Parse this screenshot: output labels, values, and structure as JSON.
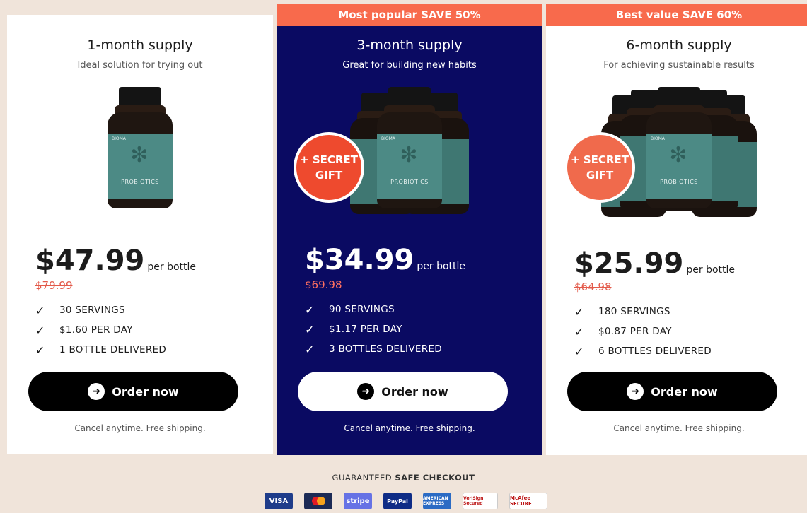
{
  "plans": [
    {
      "banner": "",
      "title": "1-month supply",
      "subtitle": "Ideal solution for trying out",
      "gift": "",
      "price": "$47.99",
      "per": "per bottle",
      "old_price": "$79.99",
      "features": [
        "30 SERVINGS",
        "$1.60 PER DAY",
        "1 BOTTLE DELIVERED"
      ],
      "order_label": "Order now",
      "note": "Cancel anytime. Free shipping."
    },
    {
      "banner": "Most popular SAVE 50%",
      "title": "3-month supply",
      "subtitle": "Great for building new habits",
      "gift": "+ SECRET GIFT",
      "price": "$34.99",
      "per": "per bottle",
      "old_price": "$69.98",
      "features": [
        "90 SERVINGS",
        "$1.17 PER DAY",
        "3 BOTTLES DELIVERED"
      ],
      "order_label": "Order now",
      "note": "Cancel anytime. Free shipping."
    },
    {
      "banner": "Best value SAVE 60%",
      "title": "6-month supply",
      "subtitle": "For achieving sustainable results",
      "gift": "+ SECRET GIFT",
      "price": "$25.99",
      "per": "per bottle",
      "old_price": "$64.98",
      "features": [
        "180 SERVINGS",
        "$0.87 PER DAY",
        "6 BOTTLES DELIVERED"
      ],
      "order_label": "Order now",
      "note": "Cancel anytime. Free shipping."
    }
  ],
  "product": {
    "brand": "BIOMA",
    "name": "PROBIOTICS"
  },
  "checkout": {
    "prefix": "GUARANTEED",
    "strong": "SAFE CHECKOUT"
  },
  "payments": [
    "VISA",
    "MC",
    "stripe",
    "PayPal",
    "AMERICAN EXPRESS",
    "VeriSign Secured",
    "McAfee SECURE"
  ],
  "colors": {
    "accent": "#f86a4c",
    "popular_bg": "#0a0a62",
    "page_bg": "#f0e4da"
  }
}
